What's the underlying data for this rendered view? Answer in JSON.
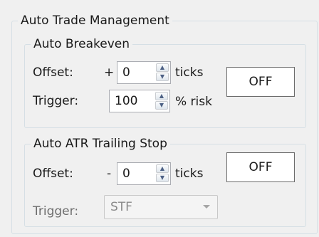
{
  "panel": {
    "title": "Auto Trade Management"
  },
  "breakeven": {
    "title": "Auto Breakeven",
    "offset_label": "Offset:",
    "offset_sign": "+",
    "offset_value": "0",
    "offset_unit": "ticks",
    "trigger_label": "Trigger:",
    "trigger_value": "100",
    "trigger_unit": "% risk",
    "toggle_label": "OFF"
  },
  "atr_trailing": {
    "title": "Auto ATR Trailing Stop",
    "offset_label": "Offset:",
    "offset_sign": "-",
    "offset_value": "0",
    "offset_unit": "ticks",
    "trigger_label": "Trigger:",
    "trigger_selected": "STF",
    "toggle_label": "OFF"
  },
  "icons": {
    "spin_up": "arrow-up-icon",
    "spin_down": "arrow-down-icon",
    "dropdown": "chevron-down-icon"
  }
}
